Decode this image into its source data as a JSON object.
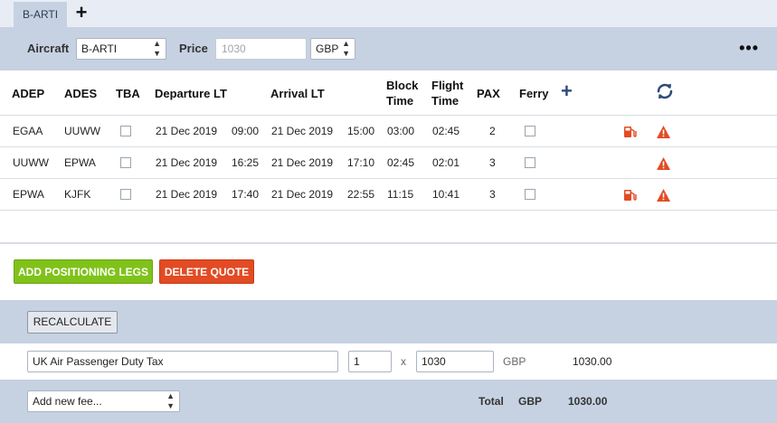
{
  "tabs": [
    {
      "label": "B-ARTI",
      "active": true
    }
  ],
  "toolbar": {
    "aircraft_label": "Aircraft",
    "aircraft_value": "B-ARTI",
    "price_label": "Price",
    "price_placeholder": "1030",
    "currency_value": "GBP"
  },
  "table": {
    "headers": {
      "adep": "ADEP",
      "ades": "ADES",
      "tba": "TBA",
      "departure": "Departure LT",
      "arrival": "Arrival LT",
      "block_1": "Block",
      "block_2": "Time",
      "flight_1": "Flight",
      "flight_2": "Time",
      "pax": "PAX",
      "ferry": "Ferry"
    },
    "rows": [
      {
        "adep": "EGAA",
        "ades": "UUWW",
        "dep_date": "21 Dec 2019",
        "dep_time": "09:00",
        "arr_date": "21 Dec 2019",
        "arr_time": "15:00",
        "block": "03:00",
        "flight": "02:45",
        "pax": "2",
        "fuel_icon": true,
        "warning_icon": true
      },
      {
        "adep": "UUWW",
        "ades": "EPWA",
        "dep_date": "21 Dec 2019",
        "dep_time": "16:25",
        "arr_date": "21 Dec 2019",
        "arr_time": "17:10",
        "block": "02:45",
        "flight": "02:01",
        "pax": "3",
        "fuel_icon": false,
        "warning_icon": true
      },
      {
        "adep": "EPWA",
        "ades": "KJFK",
        "dep_date": "21 Dec 2019",
        "dep_time": "17:40",
        "arr_date": "21 Dec 2019",
        "arr_time": "22:55",
        "block": "11:15",
        "flight": "10:41",
        "pax": "3",
        "fuel_icon": true,
        "warning_icon": true
      }
    ]
  },
  "actions": {
    "add_positioning": "ADD POSITIONING LEGS",
    "delete_quote": "DELETE QUOTE",
    "recalculate": "RECALCULATE"
  },
  "fees": [
    {
      "name": "UK Air Passenger Duty Tax",
      "quantity": "1",
      "multiplier": "x",
      "price": "1030",
      "currency": "GBP",
      "amount": "1030.00"
    }
  ],
  "footer": {
    "add_fee_placeholder": "Add new fee...",
    "total_label": "Total",
    "total_currency": "GBP",
    "total_value": "1030.00"
  },
  "colors": {
    "bar": "#c6d2e2",
    "green_button": "#80c21a",
    "red_button": "#e24b23",
    "accent_icon": "#2f4a77",
    "alert_icon": "#e24b23"
  }
}
